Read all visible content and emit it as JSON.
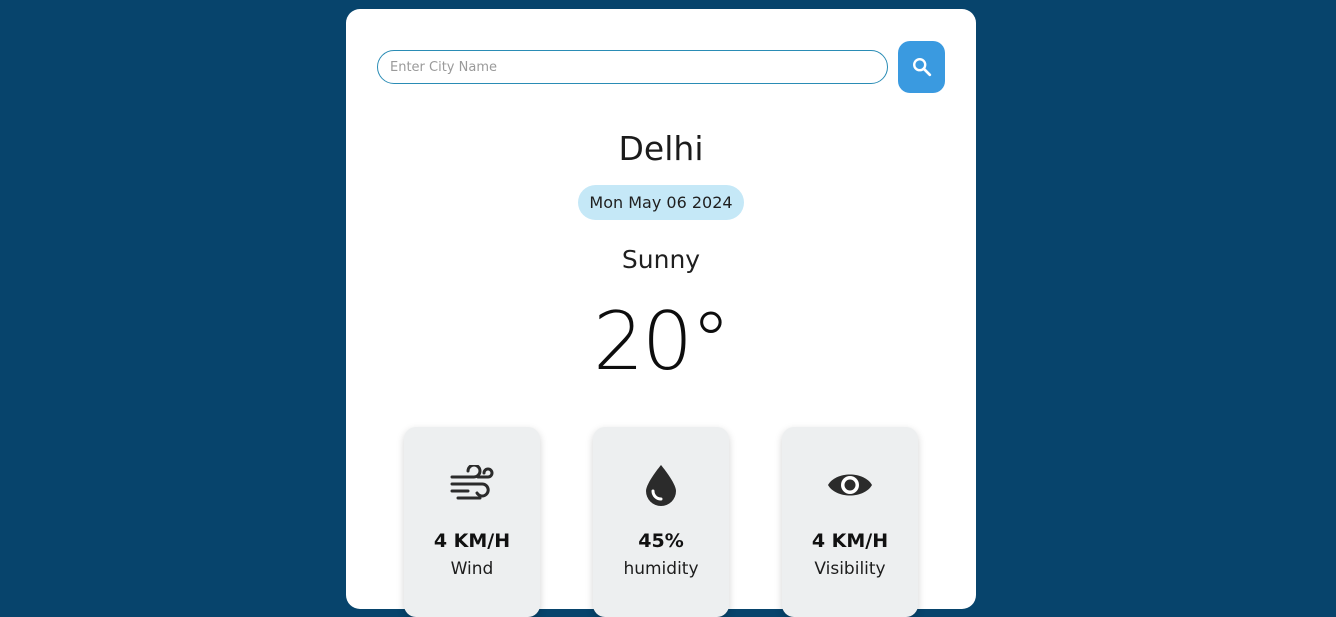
{
  "search": {
    "placeholder": "Enter City Name",
    "button_icon": "search-icon"
  },
  "location": {
    "city": "Delhi",
    "date": "Mon May 06 2024"
  },
  "weather": {
    "condition": "Sunny",
    "temperature": "20°"
  },
  "stats": [
    {
      "icon": "wind-icon",
      "value": "4 KM/H",
      "label": "Wind"
    },
    {
      "icon": "water-drop-icon",
      "value": "45%",
      "label": "humidity"
    },
    {
      "icon": "eye-icon",
      "value": "4 KM/H",
      "label": "Visibility"
    }
  ],
  "colors": {
    "page_background": "#07446c",
    "card_background": "#ffffff",
    "accent_button": "#3a9ae0",
    "date_badge": "#c5e8f7",
    "stat_card": "#edeff0",
    "icon_color": "#2b2b2b"
  }
}
